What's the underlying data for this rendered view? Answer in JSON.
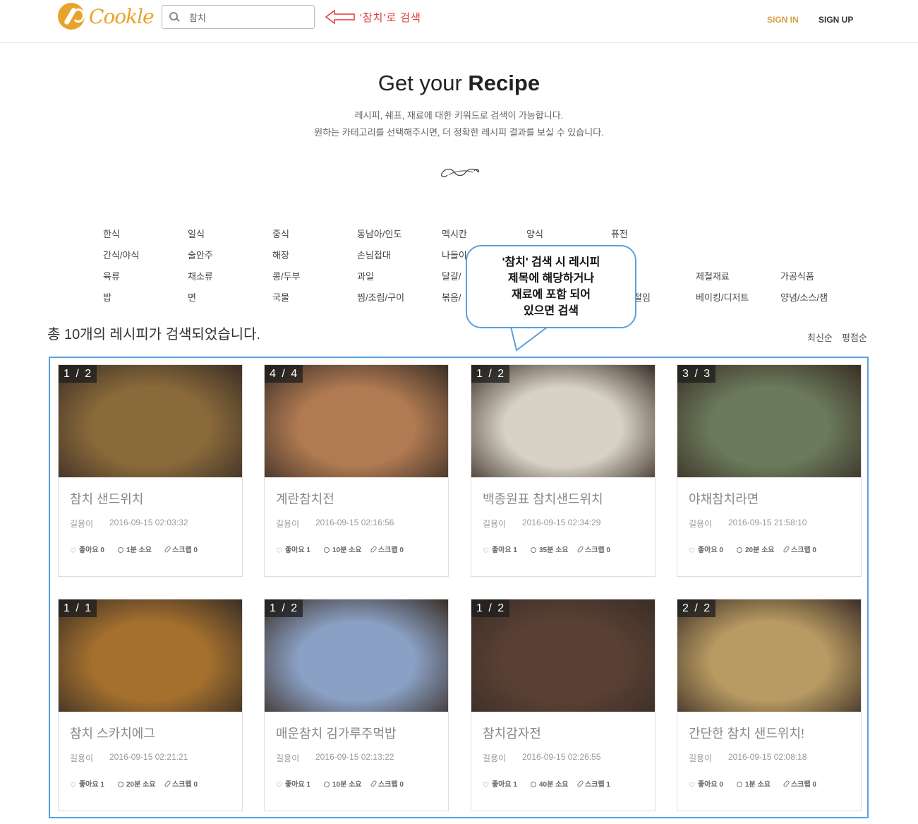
{
  "header": {
    "logo_text": "Cookle",
    "search": {
      "value": "참치",
      "placeholder": ""
    },
    "annotation": "'참치'로 검색",
    "sign_in": "SIGN IN",
    "sign_up": "SIGN UP"
  },
  "hero": {
    "title_light": "Get your ",
    "title_bold": "Recipe",
    "desc_line1": "레시피, 쉐프, 재료에 대한 키워드로 검색이 가능합니다.",
    "desc_line2": "원하는 카테고리를 선택해주시면, 더 정확한 레시피 결과를 보실 수 있습니다."
  },
  "categories": [
    [
      "한식",
      "일식",
      "중식",
      "동남아/인도",
      "멕시칸",
      "양식",
      "퓨전"
    ],
    [
      "간식/야식",
      "술안주",
      "해장",
      "손님접대",
      "나들이"
    ],
    [
      "육류",
      "채소류",
      "콩/두부",
      "과일",
      "달걀/",
      "제철재료",
      "가공식품"
    ],
    [
      "밥",
      "면",
      "국물",
      "찜/조림/구이",
      "볶음/",
      "절임",
      "베이킹/디저트",
      "양념/소스/잼"
    ]
  ],
  "callout": {
    "line1": "'참치' 검색 시 레시피",
    "line2": "제목에 해당하거나",
    "line3": "재료에 포함 되어",
    "line4": "있으면 검색"
  },
  "results": {
    "count_text": "총 10개의 레시피가 검색되었습니다.",
    "sort_newest": "최신순",
    "sort_rating": "평점순"
  },
  "recipes": [
    {
      "counter": "1 / 2",
      "title": "참치 샌드위치",
      "author": "길용이",
      "date": "2016-09-15 02:03:32",
      "likes": "좋아요 0",
      "time": "1분 소요",
      "scrap": "스크랩 0",
      "img_color": "#8a6a3a"
    },
    {
      "counter": "4 / 4",
      "title": "계란참치전",
      "author": "길용이",
      "date": "2016-09-15 02:16:56",
      "likes": "좋아요 1",
      "time": "10분 소요",
      "scrap": "스크랩 0",
      "img_color": "#b07a52"
    },
    {
      "counter": "1 / 2",
      "title": "백종원표 참치샌드위치",
      "author": "길용이",
      "date": "2016-09-15 02:34:29",
      "likes": "좋아요 1",
      "time": "35분 소요",
      "scrap": "스크랩 0",
      "img_color": "#d8d2c6"
    },
    {
      "counter": "3 / 3",
      "title": "야채참치라면",
      "author": "길용이",
      "date": "2016-09-15 21:58:10",
      "likes": "좋아요 0",
      "time": "20분 소요",
      "scrap": "스크랩 0",
      "img_color": "#6a7a5a"
    },
    {
      "counter": "1 / 1",
      "title": "참치 스카치에그",
      "author": "길용이",
      "date": "2016-09-15 02:21:21",
      "likes": "좋아요 1",
      "time": "20분 소요",
      "scrap": "스크랩 0",
      "img_color": "#a4702e"
    },
    {
      "counter": "1 / 2",
      "title": "매운참치 김가루주먹밥",
      "author": "길용이",
      "date": "2016-09-15 02:13:22",
      "likes": "좋아요 1",
      "time": "10분 소요",
      "scrap": "스크랩 0",
      "img_color": "#8aa0c4"
    },
    {
      "counter": "1 / 2",
      "title": "참치감자전",
      "author": "길용이",
      "date": "2016-09-15 02:26:55",
      "likes": "좋아요 1",
      "time": "40분 소요",
      "scrap": "스크랩 1",
      "img_color": "#5a4034"
    },
    {
      "counter": "2 / 2",
      "title": "간단한 참치 샌드위치!",
      "author": "길용이",
      "date": "2016-09-15 02:08:18",
      "likes": "좋아요 0",
      "time": "1분 소요",
      "scrap": "스크랩 0",
      "img_color": "#b89a62"
    }
  ]
}
